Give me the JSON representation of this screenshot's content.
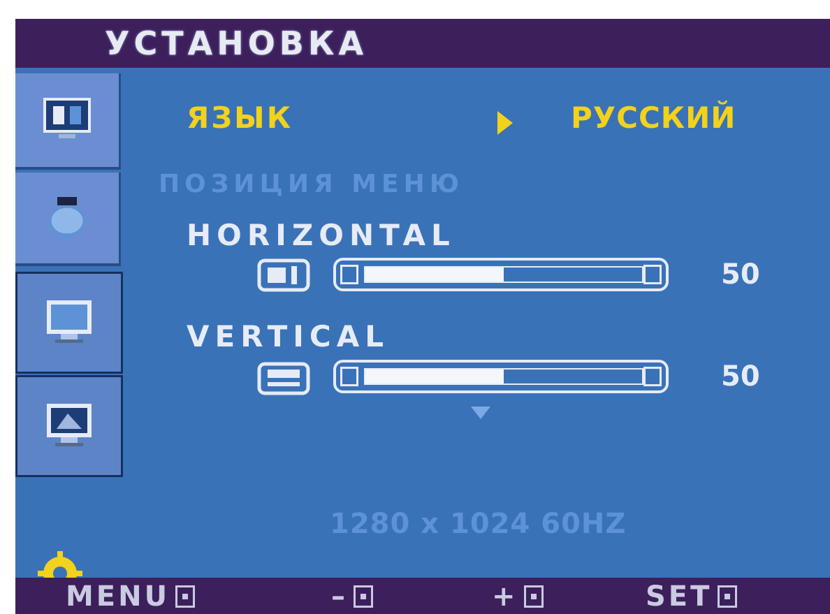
{
  "header": {
    "title": "УСТАНОВКА"
  },
  "sidebar": {
    "items": [
      {
        "icon": "picture-icon",
        "selected": false
      },
      {
        "icon": "color-icon",
        "selected": false
      },
      {
        "icon": "monitor-icon",
        "selected": true
      },
      {
        "icon": "image-monitor-icon",
        "selected": true
      }
    ],
    "settings_icon": "sun-gear-icon"
  },
  "language": {
    "label": "ЯЗЫК",
    "value": "РУССКИЙ"
  },
  "menu_position": {
    "label": "ПОЗИЦИЯ МЕНЮ"
  },
  "horizontal": {
    "label": "HORIZONTAL",
    "value": "50",
    "level_percent": 50
  },
  "vertical": {
    "label": "VERTICAL",
    "value": "50",
    "level_percent": 50
  },
  "status": {
    "resolution": "1280 x 1024 60HZ"
  },
  "footer": {
    "menu_label": "MENU",
    "minus_label": "–",
    "plus_label": "+",
    "set_label": "SET"
  },
  "colors": {
    "background": "#3a72b8",
    "bar": "#3d1f5c",
    "highlight": "#f2d21a",
    "text": "#e6ebf5",
    "dim_text": "#5d93d6"
  }
}
